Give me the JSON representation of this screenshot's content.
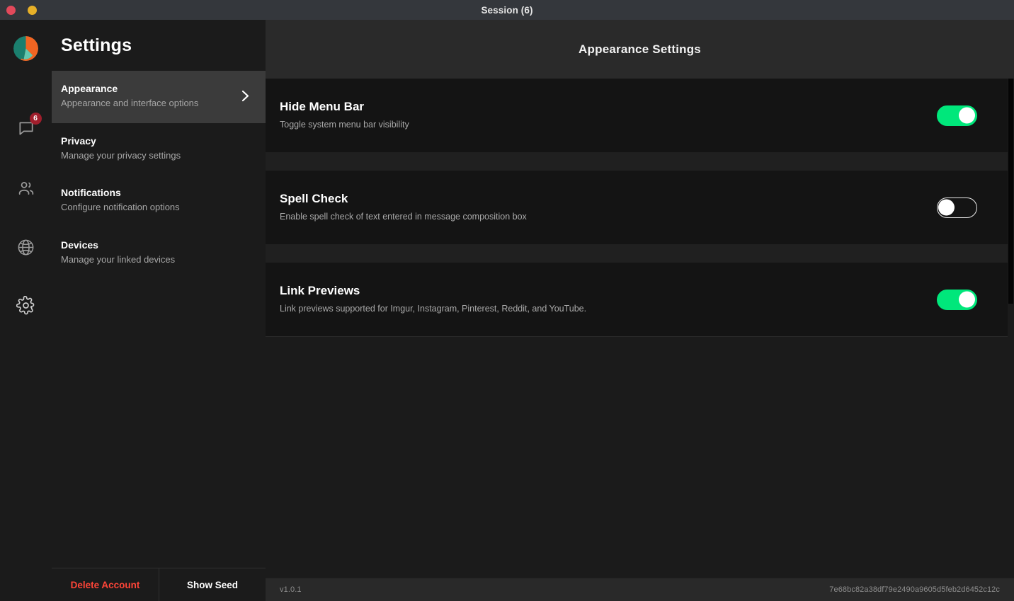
{
  "window": {
    "title": "Session (6)",
    "controls": [
      {
        "name": "close",
        "color": "#e2495b"
      },
      {
        "name": "minimize",
        "color": "#e7b028"
      }
    ]
  },
  "rail": {
    "logo_alt": "session-logo",
    "items": [
      {
        "icon": "chat-bubble-icon",
        "badge": "6"
      },
      {
        "icon": "contacts-icon",
        "badge": ""
      },
      {
        "icon": "globe-icon",
        "badge": ""
      },
      {
        "icon": "gear-icon",
        "badge": ""
      }
    ]
  },
  "sidebar": {
    "title": "Settings",
    "items": [
      {
        "label": "Appearance",
        "desc": "Appearance and interface options",
        "active": true
      },
      {
        "label": "Privacy",
        "desc": "Manage your privacy settings",
        "active": false
      },
      {
        "label": "Notifications",
        "desc": "Configure notification options",
        "active": false
      },
      {
        "label": "Devices",
        "desc": "Manage your linked devices",
        "active": false
      }
    ],
    "footer": {
      "delete_account_label": "Delete Account",
      "show_seed_label": "Show Seed",
      "delete_color": "#ff4538"
    }
  },
  "main": {
    "header_title": "Appearance Settings",
    "settings": [
      {
        "title": "Hide Menu Bar",
        "desc": "Toggle system menu bar visibility",
        "toggle_state": "on"
      },
      {
        "title": "Spell Check",
        "desc": "Enable spell check of text entered in message composition box",
        "toggle_state": "off"
      },
      {
        "title": "Link Previews",
        "desc": "Link previews supported for Imgur, Instagram, Pinterest, Reddit, and YouTube.",
        "toggle_state": "on"
      }
    ]
  },
  "statusbar": {
    "version": "v1.0.1",
    "commit_hash": "7e68bc82a38df79e2490a9605d5feb2d6452c12c"
  },
  "colors": {
    "accent_green": "#00e77b",
    "danger_red": "#ff4538",
    "badge_red": "#a01e2c",
    "logo_orange": "#f26522",
    "logo_teal": "#1b7f6e"
  }
}
